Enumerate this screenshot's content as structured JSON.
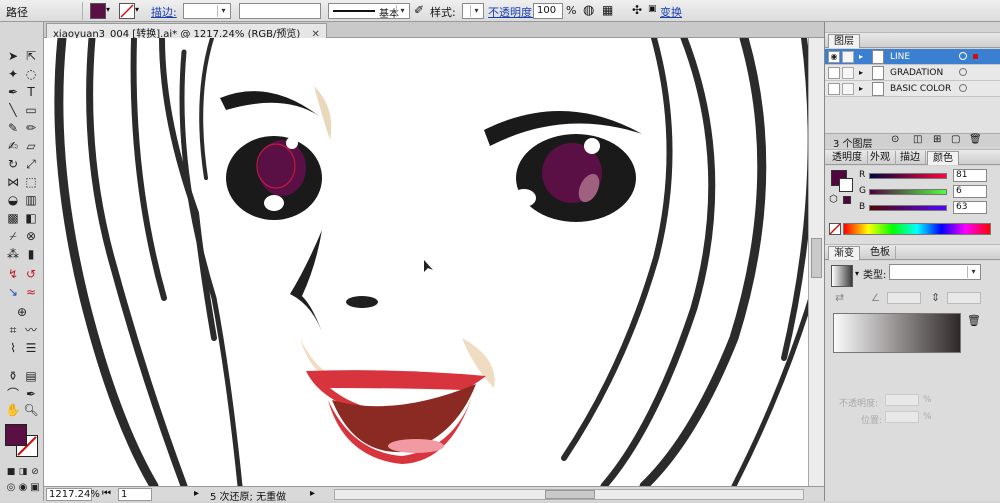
{
  "control_bar": {
    "object_type": "路径",
    "stroke_label": "描边:",
    "stroke_style": "基本",
    "style_label": "样式:",
    "opacity_label": "不透明度:",
    "opacity_value": "100",
    "opacity_unit": "%",
    "transform_label": "变换",
    "fill_color": "#5a0f45"
  },
  "document": {
    "tab_title": "xiaoyuan3_004 [转换].ai* @ 1217.24% (RGB/预览)",
    "close_glyph": "✕"
  },
  "status_bar": {
    "zoom": "1217.24%",
    "page": "1",
    "status_text": "5 次还原; 无重做"
  },
  "layers_panel": {
    "title": "图层",
    "layers": [
      {
        "name": "LINE",
        "selected": true
      },
      {
        "name": "GRADATION",
        "selected": false
      },
      {
        "name": "BASIC COLOR",
        "selected": false
      }
    ],
    "count_label": "3 个图层"
  },
  "color_panel": {
    "tabs": [
      "透明度",
      "外观",
      "描边",
      "颜色"
    ],
    "active_tab": "颜色",
    "channels": [
      {
        "label": "R",
        "value": "81"
      },
      {
        "label": "G",
        "value": "6"
      },
      {
        "label": "B",
        "value": "63"
      }
    ],
    "color": "#51063f"
  },
  "gradient_panel": {
    "tabs": [
      "渐变",
      "色板"
    ],
    "active_tab": "渐变",
    "type_label": "类型:",
    "opacity_label": "不透明度:",
    "position_label": "位置:",
    "unit": "%"
  },
  "colors": {
    "iris": "#5a0f45",
    "lip": "#d8343e",
    "skin_shadow": "#f0dcc0",
    "outline": "#2b2b2b"
  }
}
